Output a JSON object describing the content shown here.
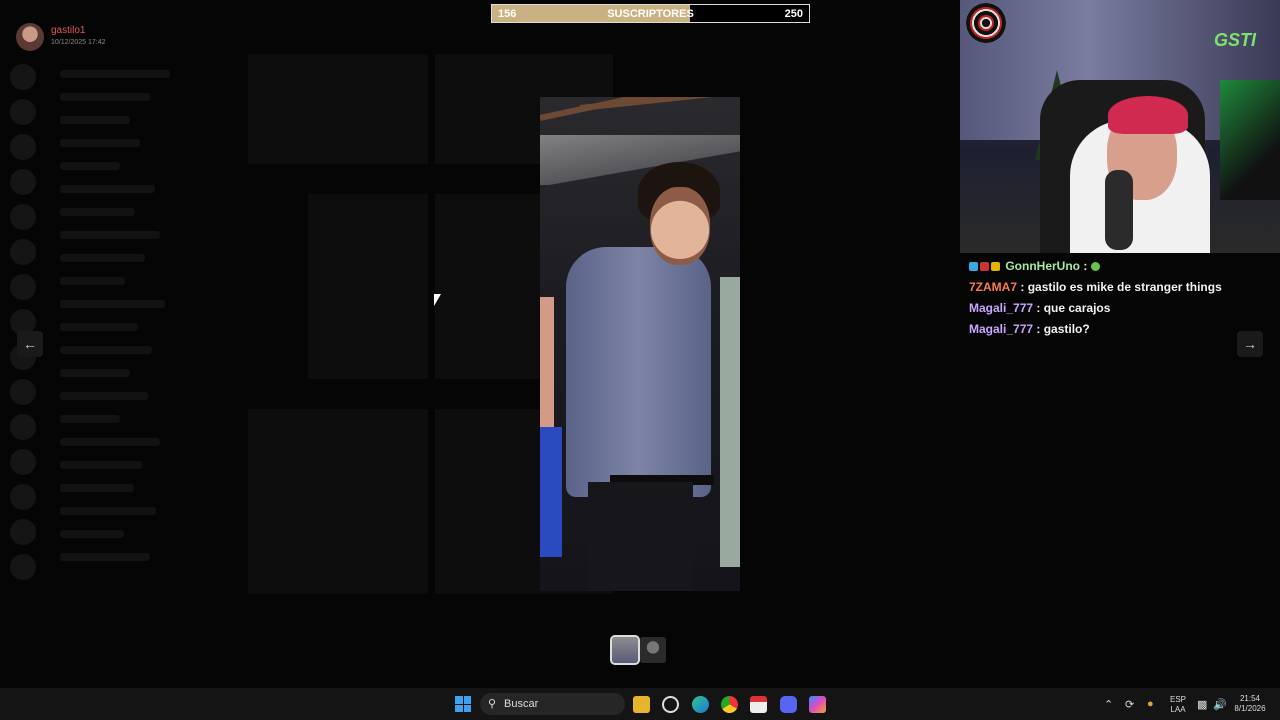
{
  "viewer": {
    "uploader_name": "gastilo1",
    "upload_date": "10/12/2025 17:42",
    "prev_icon": "arrow-left-icon",
    "next_icon": "arrow-right-icon"
  },
  "subscriber_goal": {
    "current": "156",
    "label": "SUSCRIPTORES",
    "goal": "250",
    "progress_fraction": 0.624,
    "fill_color": "#c9b181"
  },
  "webcam": {
    "overlay_logo": "GSTI"
  },
  "chat": {
    "messages": [
      {
        "user": "GonnHerUno",
        "separator": " : ",
        "text": "",
        "color": "#a8e6a8",
        "emote": "emote-icon"
      },
      {
        "user": "7ZAMA7",
        "separator": " : ",
        "text": "gastilo es mike de stranger things",
        "color": "#ff7a4d"
      },
      {
        "user": "Magali_777",
        "separator": " : ",
        "text": "que carajos",
        "color": "#c9a6ff"
      },
      {
        "user": "Magali_777",
        "separator": " : ",
        "text": "gastilo?",
        "color": "#c9a6ff"
      }
    ]
  },
  "taskbar": {
    "search_placeholder": "Buscar",
    "language": "ESP",
    "layout": "LAA",
    "time": "21:54",
    "date": "8/1/2026",
    "apps": [
      "file-explorer-icon",
      "ai-icon",
      "edge-icon",
      "chrome-icon",
      "calendar-icon",
      "discord-icon",
      "copilot-icon"
    ]
  }
}
